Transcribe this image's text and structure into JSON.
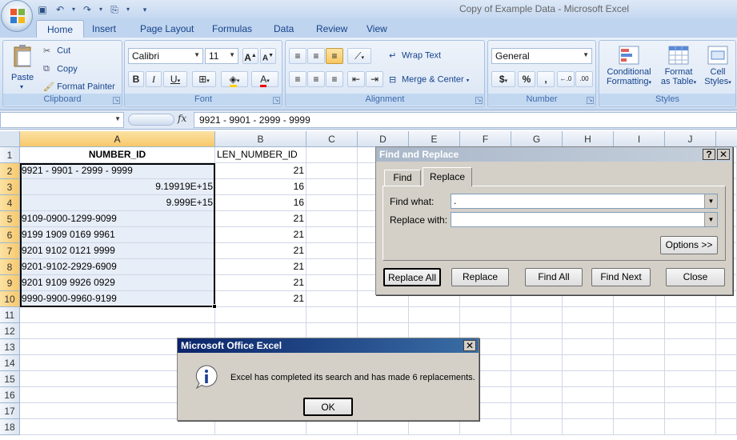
{
  "window": {
    "title": "Copy of Example Data - Microsoft Excel"
  },
  "ribbon": {
    "tabs": [
      "Home",
      "Insert",
      "Page Layout",
      "Formulas",
      "Data",
      "Review",
      "View"
    ],
    "clipboard": {
      "paste": "Paste",
      "cut": "Cut",
      "copy": "Copy",
      "format_painter": "Format Painter",
      "label": "Clipboard"
    },
    "font": {
      "name": "Calibri",
      "size": "11",
      "label": "Font"
    },
    "alignment": {
      "wrap_text": "Wrap Text",
      "merge_center": "Merge & Center",
      "label": "Alignment"
    },
    "number": {
      "format": "General",
      "label": "Number"
    },
    "styles": {
      "conditional": "Conditional",
      "conditional2": "Formatting",
      "format_as": "Format",
      "format_as2": "as Table",
      "cell_styles": "Cell",
      "cell_styles2": "Styles",
      "label": "Styles"
    }
  },
  "formula_bar": {
    "fx": "fx",
    "value": "9921 - 9901 - 2999 - 9999"
  },
  "sheet": {
    "columns": [
      "A",
      "B",
      "C",
      "D",
      "E",
      "F",
      "G",
      "H",
      "I",
      "J"
    ],
    "rows": [
      "1",
      "2",
      "3",
      "4",
      "5",
      "6",
      "7",
      "8",
      "9",
      "10",
      "11",
      "12",
      "13",
      "14",
      "15",
      "16",
      "17",
      "18"
    ],
    "header_a": "NUMBER_ID",
    "header_b": "LEN_NUMBER_ID",
    "col_a": [
      "9921 - 9901 - 2999 - 9999",
      "9.19919E+15",
      "9.999E+15",
      "9109-0900-1299-9099",
      "9199 1909 0169 9961",
      "9201 9102 0121 9999",
      "9201-9102-2929-6909",
      "9201 9109 9926 0929",
      "9990-9900-9960-9199"
    ],
    "col_b": [
      "21",
      "16",
      "16",
      "21",
      "21",
      "21",
      "21",
      "21",
      "21"
    ]
  },
  "find_replace": {
    "title": "Find and Replace",
    "help": "?",
    "close": "✕",
    "tab_find": "Find",
    "tab_replace": "Replace",
    "find_label": "Find what:",
    "find_value": ".",
    "replace_label": "Replace with:",
    "replace_value": "",
    "options": "Options >>",
    "replace_all": "Replace All",
    "replace": "Replace",
    "find_all": "Find All",
    "find_next": "Find Next",
    "close_btn": "Close"
  },
  "msgbox": {
    "title": "Microsoft Office Excel",
    "close": "✕",
    "message": "Excel has completed its search and has made 6 replacements.",
    "ok": "OK"
  }
}
